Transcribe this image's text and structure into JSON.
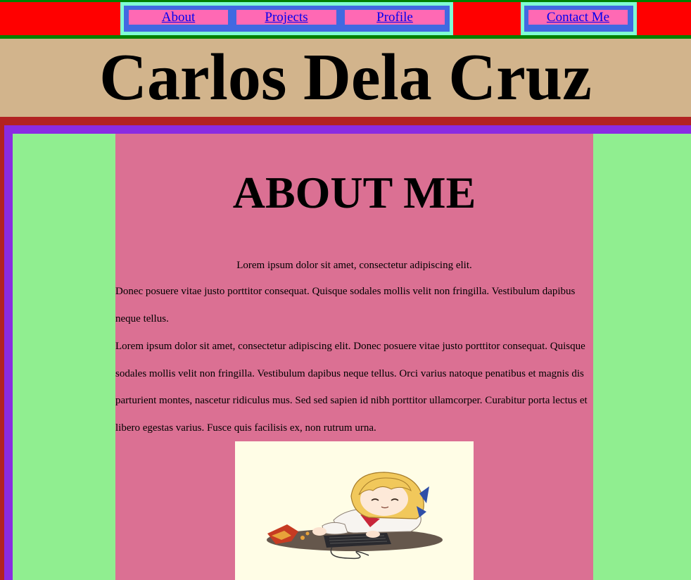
{
  "nav": {
    "links": [
      {
        "label": "About"
      },
      {
        "label": "Projects"
      },
      {
        "label": "Profile"
      }
    ],
    "contact": {
      "label": "Contact Me"
    }
  },
  "header": {
    "title": "Carlos Dela Cruz"
  },
  "main": {
    "heading": "ABOUT ME",
    "intro": "Lorem ipsum dolor sit amet, consectetur adipiscing elit.",
    "paragraph1": "Donec posuere vitae justo porttitor consequat. Quisque sodales mollis velit non fringilla. Vestibulum dapibus neque tellus.",
    "paragraph2": "Lorem ipsum dolor sit amet, consectetur adipiscing elit. Donec posuere vitae justo porttitor consequat. Quisque sodales mollis velit non fringilla. Vestibulum dapibus neque tellus. Orci varius natoque penatibus et magnis dis parturient montes, nascetur ridiculus mus. Sed sed sapien id nibh porttitor ullamcorper. Curabitur porta lectus et libero egestas varius. Fusce quis facilisis ex, non rutrum urna."
  },
  "colors": {
    "nav_bar": "#ff0000",
    "nav_border": "#008000",
    "nav_box_outer": "#7fffd4",
    "nav_box_inner": "#4169e1",
    "nav_link_bg": "#ff69b4",
    "header_bg": "#d2b48c",
    "frame_red": "#b22222",
    "frame_purple": "#8a2be2",
    "side_green": "#90ee90",
    "content_bg": "#db7093",
    "image_bg": "#fffde6"
  },
  "image": {
    "icon": "chibi-girl-at-computer-illustration"
  }
}
